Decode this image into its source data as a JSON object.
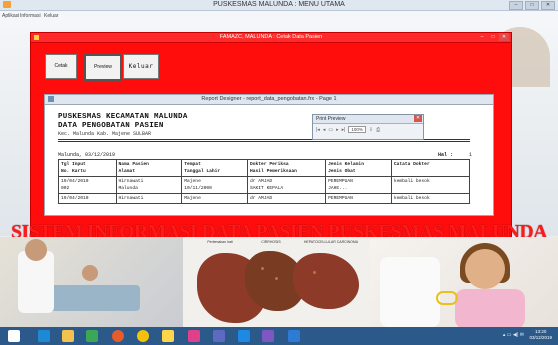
{
  "outer_window": {
    "title": "PUSKESMAS MALUNDA : MENU UTAMA",
    "menu": [
      "Aplikasi",
      "Informasi",
      "Keluar"
    ]
  },
  "red_window": {
    "title": "FAMAZC, MALUNDA : Cetak Data Pasien",
    "buttons": {
      "cetak": "Cetak",
      "preview": "Preview",
      "keluar": "Keluar"
    }
  },
  "report_designer": {
    "title": "Report Designer - report_data_pengobatan.frx - Page 1",
    "report": {
      "heading_line1": "PUSKESMAS KECAMATAN MALUNDA",
      "heading_line2": "DATA PENGOBATAN PASIEN",
      "address": "Kec. Malunda Kab. Majene  SULBAR",
      "date": "Malunda, 03/12/2019",
      "hal_label": "Hal :",
      "hal_value": "1",
      "columns": [
        [
          "Tgl Input",
          "No. Kartu"
        ],
        [
          "Nama Pasien",
          "Alamat"
        ],
        [
          "Tempat",
          "Tanggal Lahir"
        ],
        [
          "Dokter Periksa",
          "Hasil Pemeriksaan"
        ],
        [
          "Jenis Kelamin",
          "Jenis Obat"
        ],
        [
          "Catata Dokter",
          ""
        ]
      ],
      "rows": [
        [
          [
            "19/04/2010",
            "002"
          ],
          [
            "Hirnawati",
            "Malunda"
          ],
          [
            "Majene",
            "10/11/2000"
          ],
          [
            "dr AMJAD",
            "SAKIT KEPALA"
          ],
          [
            "PEREMPUAN",
            "JAHE..."
          ],
          [
            "kembali besok",
            ""
          ]
        ],
        [
          [
            "19/04/2010",
            ""
          ],
          [
            "Hirnawati",
            ""
          ],
          [
            "Majene",
            ""
          ],
          [
            "dr AMJAD",
            ""
          ],
          [
            "PEREMPUAN",
            ""
          ],
          [
            "kembali besok",
            ""
          ]
        ]
      ]
    }
  },
  "print_preview": {
    "title": "Print Preview",
    "zoom": "100%"
  },
  "banner_text": "SISTEM INFORMASI DATA PASIEN PUSKESMAS MALUNDA",
  "photo_labels": {
    "liver1": "Perlemakan hati",
    "liver2": "CIRRHOSIS",
    "liver3": "HEPATOCELLULAR CARCINOMA"
  },
  "taskbar": {
    "time": "13:20",
    "date": "03/12/2019"
  },
  "colors": {
    "red_window": "#ff0d0d",
    "banner": "#ff1a1a",
    "taskbar": "#2b5a8a"
  }
}
